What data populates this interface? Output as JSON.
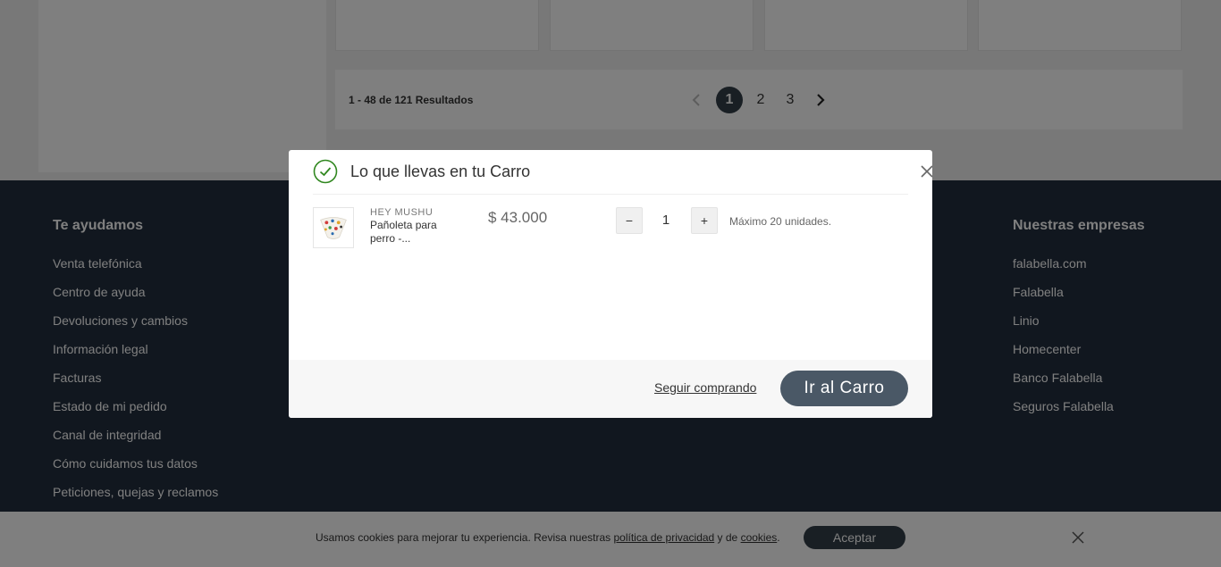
{
  "pagination": {
    "results": "1 - 48 de 121 Resultados",
    "prev_icon": "chevron-left-icon",
    "next_icon": "chevron-right-icon",
    "pages": [
      "1",
      "2",
      "3"
    ],
    "active_page": "1"
  },
  "footer": {
    "help": {
      "title": "Te ayudamos",
      "links": [
        "Venta telefónica",
        "Centro de ayuda",
        "Devoluciones y cambios",
        "Información legal",
        "Facturas",
        "Estado de mi pedido",
        "Canal de integridad",
        "Cómo cuidamos tus datos",
        "Peticiones, quejas y reclamos"
      ]
    },
    "companies": {
      "title": "Nuestras empresas",
      "links": [
        "falabella.com",
        "Falabella",
        "Linio",
        "Homecenter",
        "Banco Falabella",
        "Seguros Falabella"
      ]
    }
  },
  "cookie_bar": {
    "text_before": "Usamos cookies para mejorar tu experiencia. Revisa nuestras ",
    "privacy_link": "política de privacidad",
    "text_middle": " y de ",
    "cookies_link": "cookies",
    "text_after": ".",
    "accept_label": "Aceptar"
  },
  "modal": {
    "title": "Lo que llevas en tu Carro",
    "item": {
      "brand": "HEY MUSHU",
      "name": "Pañoleta para perro -...",
      "price": "$ 43.000",
      "quantity": "1",
      "minus_label": "−",
      "plus_label": "+",
      "max_note": "Máximo 20 unidades."
    },
    "keep_shopping": "Seguir comprando",
    "go_to_cart": "Ir al Carro"
  },
  "colors": {
    "primary_button": "#4a5866",
    "active_page": "#333f48",
    "footer_bg": "#232f3e",
    "success": "#30871f"
  }
}
